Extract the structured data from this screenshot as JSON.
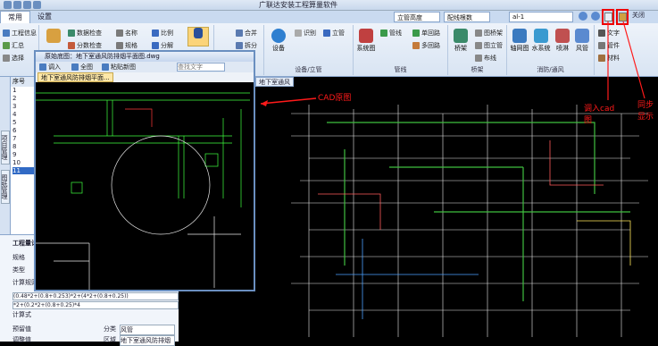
{
  "app": {
    "title": "广联达安装工程算量软件"
  },
  "ribbon": {
    "tabs": [
      "常用",
      "设置"
    ],
    "project_info": "工程信息",
    "summary": "汇总",
    "select_btn": "选择",
    "data_check": "数据检查",
    "sub_check": "分数检查",
    "name": "名称",
    "spec": "规格",
    "ratio": "比例",
    "split": "分解",
    "merge": "合并",
    "break": "拆分",
    "device": "设备",
    "identify": "识别",
    "group_device_pipe": "设备/立管",
    "riser": "立管",
    "system_map": "系统图",
    "pipeline": "管线",
    "pipe_group": "多回路",
    "single_loop": "单回路",
    "group_pipeline": "管线",
    "bridge": "桥架",
    "bridge_group": "桥架",
    "bridge_frame": "图桥架",
    "bridge_vertical": "图立管",
    "bridge_wire": "布线",
    "axis_net": "轴网图",
    "water_system": "水系统",
    "spray": "喷淋",
    "wind_pipe": "风管",
    "fire_hvac": "消防/通风",
    "material": "材料",
    "text": "文字",
    "component": "管件",
    "riser_height": "立管高度",
    "wire_count": "配线根数",
    "layer_select": "al-1"
  },
  "left": {
    "vtab1": "项目管理",
    "vtab2": "图纸管理",
    "serial": "序号",
    "rows": [
      "1",
      "2",
      "3",
      "4",
      "5",
      "6",
      "7",
      "8",
      "9",
      "10",
      "11"
    ],
    "props_title": "工程量计算",
    "prop_labels": [
      "规格",
      "类型",
      "计算规则",
      "计算式",
      "预留值",
      "调整值"
    ],
    "formula1": "(0.48*2+(0.8+0.253)*2+(4*2+(0.8+0.25))",
    "formula2": "*2+(0.2*2+(0.8+0.25)*4",
    "category_label": "分类",
    "category_value": "风管",
    "area_label": "区域",
    "area_value": "地下室通风防排烟"
  },
  "cad": {
    "title": "原始底图：地下室通风防排烟平面图.dwg",
    "import": "调入",
    "fullview": "全图",
    "paste": "粘贴新图",
    "find_placeholder": "查找文字",
    "file_tab": "地下室通风防排烟平面..."
  },
  "draw": {
    "tab1": "地下室通风"
  },
  "annotations": {
    "cad_original": "CAD原图",
    "import_cad": "调入cad图",
    "sync_display": "同步显示"
  }
}
